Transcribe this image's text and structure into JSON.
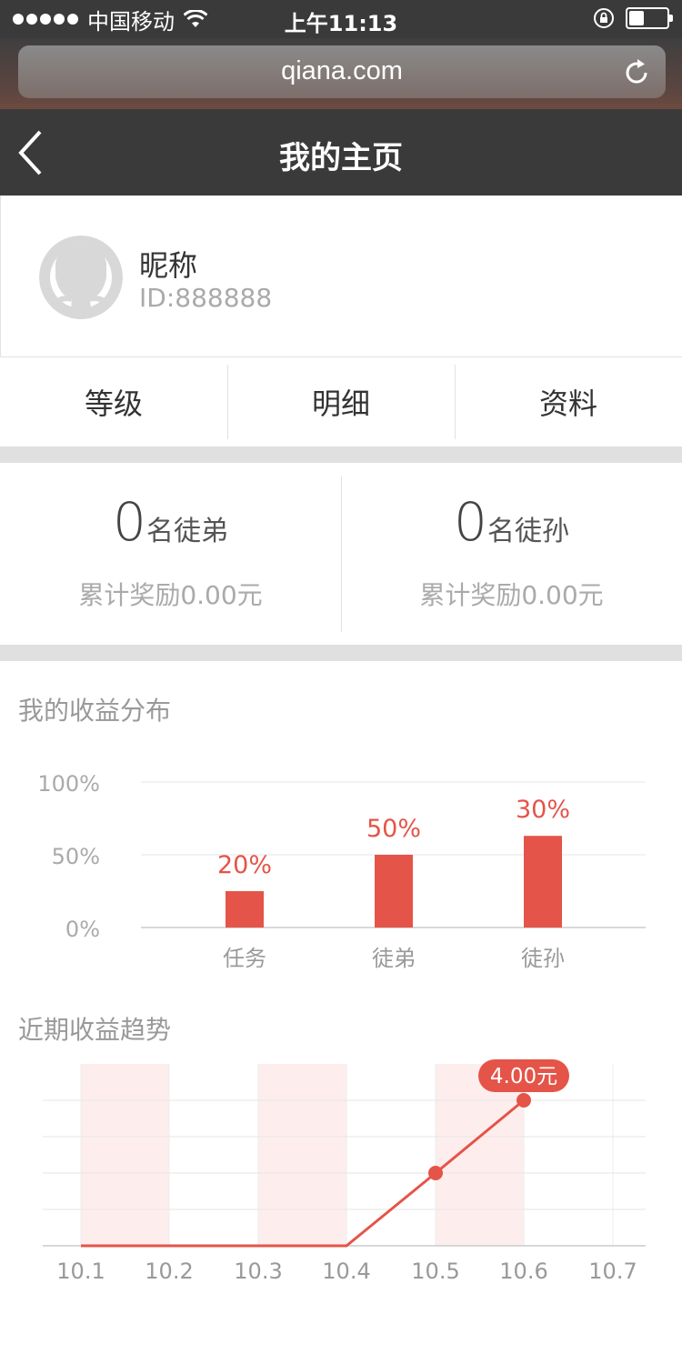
{
  "status_bar": {
    "carrier": "中国移动",
    "time": "上午11:13",
    "battery_level": 0.4
  },
  "browser": {
    "url": "qiana.com"
  },
  "nav": {
    "title": "我的主页"
  },
  "profile": {
    "nickname": "昵称",
    "id_text": "ID:888888"
  },
  "tabs": [
    {
      "label": "等级"
    },
    {
      "label": "明细"
    },
    {
      "label": "资料"
    }
  ],
  "stats": [
    {
      "count": "0",
      "label": "名徒弟",
      "reward": "累计奖励0.00元"
    },
    {
      "count": "0",
      "label": "名徒孙",
      "reward": "累计奖励0.00元"
    }
  ],
  "sections": {
    "distribution_title": "我的收益分布",
    "trend_title": "近期收益趋势"
  },
  "colors": {
    "accent": "#e55448",
    "dark_bar": "#3a3a3a",
    "separator": "#e0e0e0",
    "band": "#fdeeed"
  },
  "chart_data": [
    {
      "type": "bar",
      "title": "我的收益分布",
      "categories": [
        "任务",
        "徒弟",
        "徒孙"
      ],
      "values": [
        25,
        50,
        63
      ],
      "data_labels": [
        "20%",
        "50%",
        "30%"
      ],
      "yticks": [
        "0%",
        "50%",
        "100%"
      ],
      "ylim": [
        0,
        100
      ],
      "grid": true
    },
    {
      "type": "line",
      "title": "近期收益趋势",
      "x": [
        "10.1",
        "10.2",
        "10.3",
        "10.4",
        "10.5",
        "10.6",
        "10.7"
      ],
      "values": [
        0,
        0,
        0,
        0,
        2,
        4,
        null
      ],
      "marker_indices": [
        4,
        5
      ],
      "highlight_label": "4.00元",
      "highlight_index": 5,
      "shaded_ranges": [
        [
          "10.1",
          "10.2"
        ],
        [
          "10.3",
          "10.4"
        ],
        [
          "10.5",
          "10.6"
        ]
      ],
      "ylim": [
        0,
        5
      ],
      "grid": true
    }
  ]
}
